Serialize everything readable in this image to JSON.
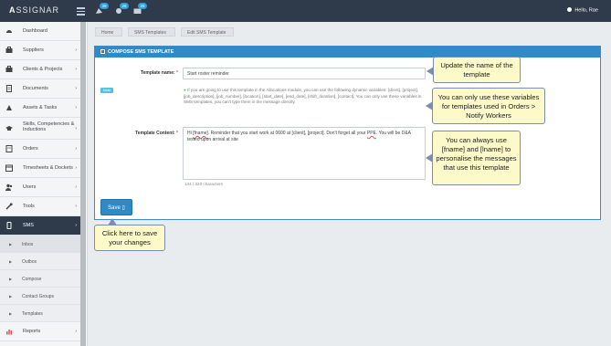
{
  "app": {
    "logo_prefix": "A",
    "logo_text": "SSIGNAR",
    "user_greeting": "Hello, Rae"
  },
  "topbar": {
    "badges": [
      "39",
      "28",
      "25"
    ]
  },
  "sidebar": {
    "items": [
      {
        "label": "Dashboard",
        "icon": "dashboard-icon",
        "chevron": ""
      },
      {
        "label": "Suppliers",
        "icon": "briefcase-icon",
        "chevron": "›"
      },
      {
        "label": "Clients & Projects",
        "icon": "suitcase-icon",
        "chevron": "›"
      },
      {
        "label": "Documents",
        "icon": "document-icon",
        "chevron": "›"
      },
      {
        "label": "Assets & Tasks",
        "icon": "asset-icon",
        "chevron": "›"
      },
      {
        "label": "Skills, Competencies & Inductions",
        "icon": "graduation-icon",
        "chevron": "›"
      },
      {
        "label": "Orders",
        "icon": "orders-icon",
        "chevron": "›"
      },
      {
        "label": "Timesheets & Dockets",
        "icon": "calendar-icon",
        "chevron": "›"
      },
      {
        "label": "Users",
        "icon": "users-icon",
        "chevron": "›"
      },
      {
        "label": "Tools",
        "icon": "wrench-icon",
        "chevron": "›"
      },
      {
        "label": "SMS",
        "icon": "mobile-icon",
        "chevron": "›"
      }
    ],
    "sms_sub": [
      "Inbox",
      "Outbox",
      "Compose",
      "Contact Groups",
      "Templates"
    ],
    "reports": {
      "label": "Reports",
      "icon": "chart-icon",
      "chevron": "›"
    }
  },
  "breadcrumb": [
    "Home",
    "SMS Templates",
    "Edit SMS Template"
  ],
  "panel": {
    "title": "COMPOSE SMS TEMPLATE",
    "name_label": "Template name:",
    "required_mark": "*",
    "name_value": "Start roster reminder",
    "note_badge": "Note",
    "note_text": "If you are going to use this template in the Allocations module, you can use the following dynamic variables: [client], [project], [job_description], [job_number], [location], [start_date], [end_date], [shift_duration], [contact]. You can only use these variables in SMS templates, you can't type them in the message directly.",
    "content_label": "Template Content:",
    "content_parts": [
      "Hi ",
      "[fname]",
      ". Reminder that you start work at 0600 at [client], [project]. Don't forget all your ",
      "PPE",
      ". You will be D&A tested upon arrival at site"
    ],
    "char_count": "144 / 320 characters",
    "save_label": "Save",
    "save_icon": "save-icon"
  },
  "callouts": {
    "name": "Update the name of the template",
    "variables": "You can only use these variables for templates used in Orders > Notify Workers",
    "personalise": "You can always use [fname] and [lname] to personalise the messages that use this template",
    "save": "Click here to save your changes"
  },
  "colors": {
    "topbar": "#2f3b4a",
    "primary": "#2f8ac8",
    "callout_bg": "#fdf9c9",
    "badge": "#2f9fd8"
  }
}
